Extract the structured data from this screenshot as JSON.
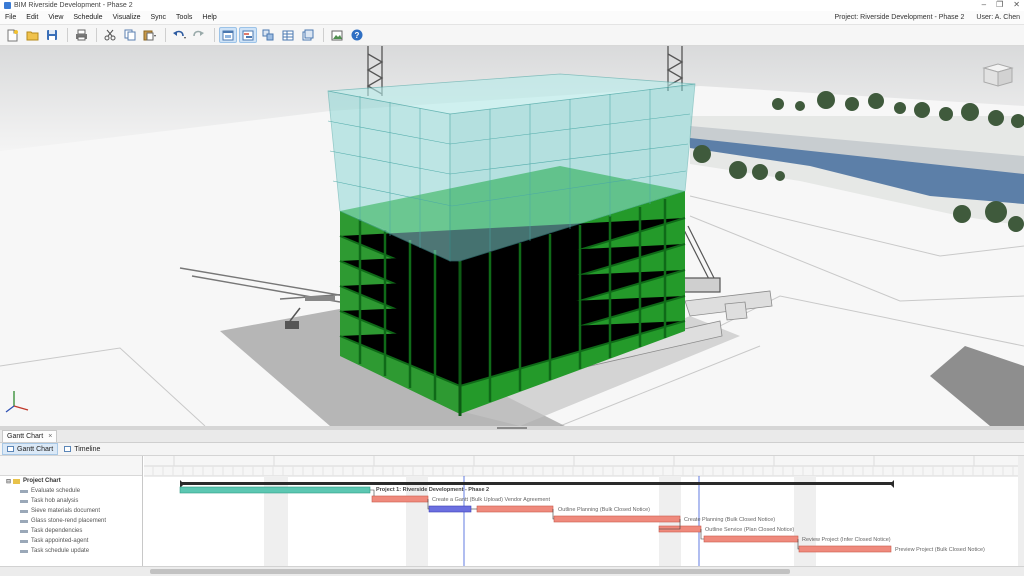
{
  "window": {
    "title": "BIM Riverside Development - Phase 2"
  },
  "menu": {
    "items": [
      "File",
      "Edit",
      "View",
      "Schedule",
      "Visualize",
      "Sync",
      "Tools",
      "Help"
    ],
    "project_label": "Project: Riverside Development - Phase 2",
    "user_label": "User: A. Chen"
  },
  "toolbar": {
    "icons": [
      "new-icon",
      "open-icon",
      "save-icon",
      "print-icon",
      "cut-icon",
      "copy-icon",
      "paste-icon",
      "undo-icon",
      "redo-icon",
      "view-icon",
      "gantt-view-icon",
      "model-view-icon",
      "table-view-icon",
      "sync-icon",
      "image-icon",
      "help-icon"
    ]
  },
  "panel": {
    "tab_label": "Gantt Chart",
    "close_glyph": "×",
    "subtabs": [
      "Gantt Chart",
      "Timeline"
    ]
  },
  "gantt": {
    "tasks": [
      {
        "label": "Project Chart",
        "summary": true
      },
      {
        "label": "Evaluate schedule"
      },
      {
        "label": "Task hob analysis"
      },
      {
        "label": "Sieve materials document"
      },
      {
        "label": "Glass stone-rend placement"
      },
      {
        "label": "Task dependencies"
      },
      {
        "label": "Task appointed-agent"
      },
      {
        "label": "Task schedule update"
      }
    ],
    "bar_labels": [
      "Project 1: Riverside Development - Phase 2",
      "Create a Gantt (Bulk Upload) Vendor Agreement",
      "Outline Planning (Bulk Closed Notice)",
      "Create Planning (Bulk Closed Notice)",
      "Outline Service (Plan Closed Notice)",
      "Review Project (Infer Closed Notice)",
      "Preview Project (Bulk Closed Notice)"
    ],
    "colors": {
      "summary": "#2a2a2a",
      "teal": "#5cc7b2",
      "salmon": "#ef8a7d",
      "blue": "#6b6fe0",
      "today": "#3b5bdb"
    }
  }
}
